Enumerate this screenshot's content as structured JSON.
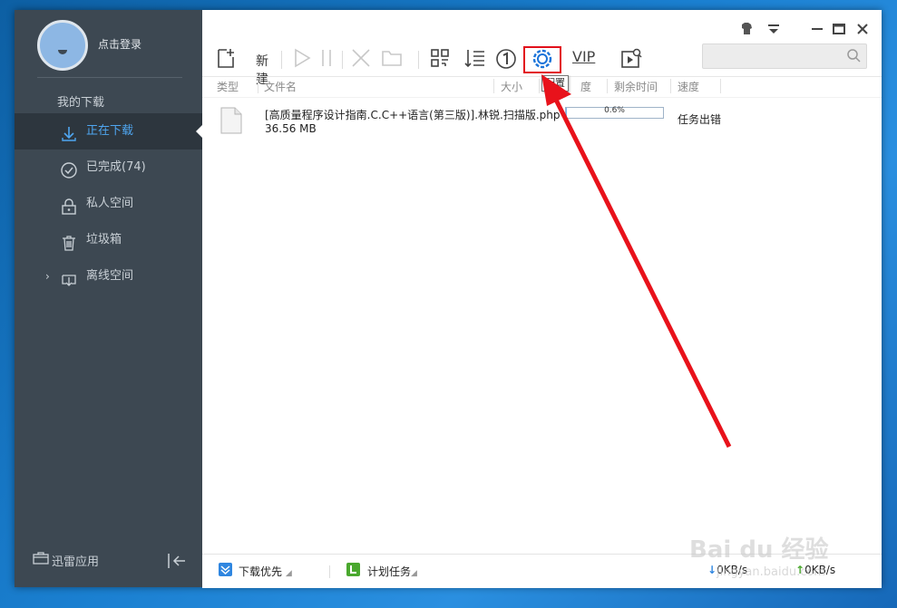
{
  "sidebar": {
    "login_label": "点击登录",
    "section_title": "我的下载",
    "items": [
      {
        "label": "正在下载",
        "icon": "download-icon"
      },
      {
        "label": "已完成(74)",
        "icon": "check-circle-icon"
      },
      {
        "label": "私人空间",
        "icon": "lock-icon"
      },
      {
        "label": "垃圾箱",
        "icon": "trash-icon"
      },
      {
        "label": "离线空间",
        "icon": "cloud-download-icon"
      }
    ],
    "apps_label": "迅雷应用"
  },
  "toolbar": {
    "new_label": "新建",
    "vip_label": "VIP",
    "settings_tooltip": "配置",
    "search_placeholder": ""
  },
  "columns": {
    "type": "类型",
    "filename": "文件名",
    "size": "大小",
    "progress": "度",
    "remaining": "剩余时间",
    "speed": "速度"
  },
  "tasks": [
    {
      "name": "[高质量程序设计指南.C.C++语言(第三版)].林锐.扫描版.php",
      "size": "36.56 MB",
      "progress": "0.6%",
      "progress_fraction": 0.006,
      "status": "任务出错"
    }
  ],
  "bottombar": {
    "priority_label": "下载优先",
    "schedule_label": "计划任务",
    "download_speed": "0KB/s",
    "upload_speed": "0KB/s"
  },
  "watermark": {
    "logo": "Bai du 经验",
    "url": "jingyan.baidu.com"
  },
  "colors": {
    "sidebar_bg": "#3d4852",
    "active_accent": "#4fa6f0",
    "highlight_red": "#e2101b"
  }
}
